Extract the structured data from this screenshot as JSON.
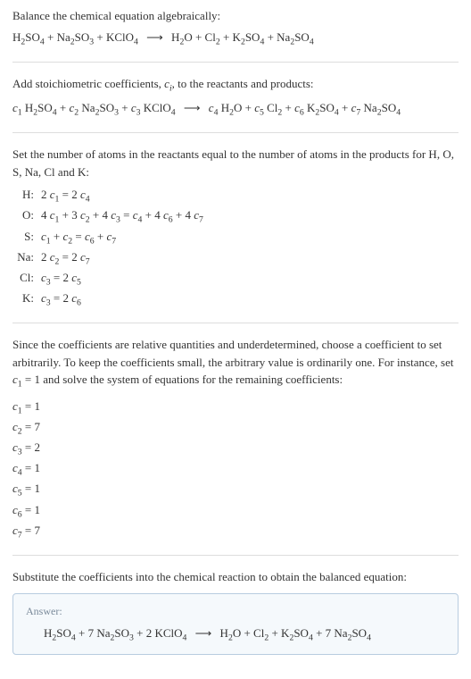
{
  "sections": {
    "intro": {
      "text": "Balance the chemical equation algebraically:",
      "equation_html": "H<sub>2</sub>SO<sub>4</sub> + Na<sub>2</sub>SO<sub>3</sub> + KClO<sub>4</sub> <span class='arrow'>⟶</span> H<sub>2</sub>O + Cl<sub>2</sub> + K<sub>2</sub>SO<sub>4</sub> + Na<sub>2</sub>SO<sub>4</sub>"
    },
    "stoich": {
      "text_html": "Add stoichiometric coefficients, <span class='italic'>c<sub>i</sub></span>, to the reactants and products:",
      "equation_html": "<span class='italic'>c</span><sub>1</sub> H<sub>2</sub>SO<sub>4</sub> + <span class='italic'>c</span><sub>2</sub> Na<sub>2</sub>SO<sub>3</sub> + <span class='italic'>c</span><sub>3</sub> KClO<sub>4</sub> <span class='arrow'>⟶</span> <span class='italic'>c</span><sub>4</sub> H<sub>2</sub>O + <span class='italic'>c</span><sub>5</sub> Cl<sub>2</sub> + <span class='italic'>c</span><sub>6</sub> K<sub>2</sub>SO<sub>4</sub> + <span class='italic'>c</span><sub>7</sub> Na<sub>2</sub>SO<sub>4</sub>"
    },
    "atoms": {
      "text": "Set the number of atoms in the reactants equal to the number of atoms in the products for H, O, S, Na, Cl and K:",
      "rows": [
        {
          "label": "H:",
          "eq_html": "2 <span class='italic'>c</span><sub>1</sub> = 2 <span class='italic'>c</span><sub>4</sub>"
        },
        {
          "label": "O:",
          "eq_html": "4 <span class='italic'>c</span><sub>1</sub> + 3 <span class='italic'>c</span><sub>2</sub> + 4 <span class='italic'>c</span><sub>3</sub> = <span class='italic'>c</span><sub>4</sub> + 4 <span class='italic'>c</span><sub>6</sub> + 4 <span class='italic'>c</span><sub>7</sub>"
        },
        {
          "label": "S:",
          "eq_html": "<span class='italic'>c</span><sub>1</sub> + <span class='italic'>c</span><sub>2</sub> = <span class='italic'>c</span><sub>6</sub> + <span class='italic'>c</span><sub>7</sub>"
        },
        {
          "label": "Na:",
          "eq_html": "2 <span class='italic'>c</span><sub>2</sub> = 2 <span class='italic'>c</span><sub>7</sub>"
        },
        {
          "label": "Cl:",
          "eq_html": "<span class='italic'>c</span><sub>3</sub> = 2 <span class='italic'>c</span><sub>5</sub>"
        },
        {
          "label": "K:",
          "eq_html": "<span class='italic'>c</span><sub>3</sub> = 2 <span class='italic'>c</span><sub>6</sub>"
        }
      ]
    },
    "solve": {
      "text_html": "Since the coefficients are relative quantities and underdetermined, choose a coefficient to set arbitrarily. To keep the coefficients small, the arbitrary value is ordinarily one. For instance, set <span class='italic'>c</span><sub>1</sub> = 1 and solve the system of equations for the remaining coefficients:",
      "coeffs": [
        {
          "html": "<span class='italic'>c</span><sub>1</sub> = 1"
        },
        {
          "html": "<span class='italic'>c</span><sub>2</sub> = 7"
        },
        {
          "html": "<span class='italic'>c</span><sub>3</sub> = 2"
        },
        {
          "html": "<span class='italic'>c</span><sub>4</sub> = 1"
        },
        {
          "html": "<span class='italic'>c</span><sub>5</sub> = 1"
        },
        {
          "html": "<span class='italic'>c</span><sub>6</sub> = 1"
        },
        {
          "html": "<span class='italic'>c</span><sub>7</sub> = 7"
        }
      ]
    },
    "final": {
      "text": "Substitute the coefficients into the chemical reaction to obtain the balanced equation:",
      "answer_label": "Answer:",
      "answer_html": "H<sub>2</sub>SO<sub>4</sub> + 7 Na<sub>2</sub>SO<sub>3</sub> + 2 KClO<sub>4</sub> <span class='arrow'>⟶</span> H<sub>2</sub>O + Cl<sub>2</sub> + K<sub>2</sub>SO<sub>4</sub> + 7 Na<sub>2</sub>SO<sub>4</sub>"
    }
  }
}
